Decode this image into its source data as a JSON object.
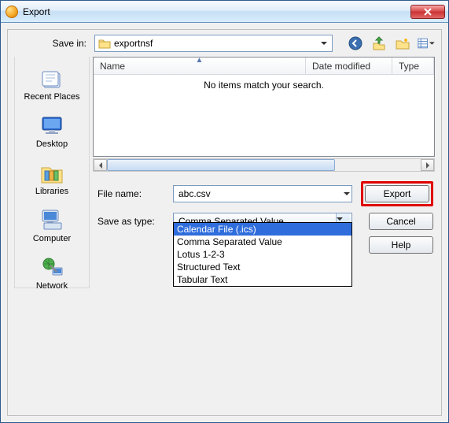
{
  "window": {
    "title": "Export"
  },
  "savein": {
    "label": "Save in:",
    "folder": "exportnsf"
  },
  "places": [
    {
      "key": "recent",
      "label": "Recent Places"
    },
    {
      "key": "desktop",
      "label": "Desktop"
    },
    {
      "key": "libraries",
      "label": "Libraries"
    },
    {
      "key": "computer",
      "label": "Computer"
    },
    {
      "key": "network",
      "label": "Network"
    }
  ],
  "filelist": {
    "columns": {
      "name": "Name",
      "date": "Date modified",
      "type": "Type"
    },
    "empty": "No items match your search."
  },
  "filename": {
    "label": "File name:",
    "value": "abc.csv"
  },
  "savetype": {
    "label": "Save as type:",
    "selected": "Comma Separated Value",
    "options": [
      "Calendar File (.ics)",
      "Comma Separated Value",
      "Lotus 1-2-3",
      "Structured Text",
      "Tabular Text"
    ],
    "highlighted_index": 0
  },
  "buttons": {
    "export": "Export",
    "cancel": "Cancel",
    "help": "Help"
  }
}
